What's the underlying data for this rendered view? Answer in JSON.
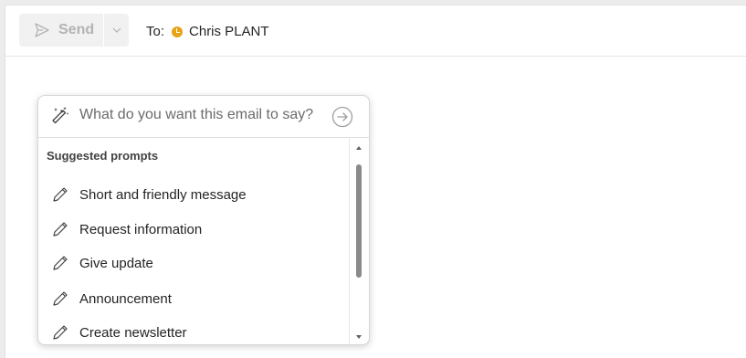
{
  "toolbar": {
    "send_label": "Send",
    "send_icon": "send-icon",
    "dropdown_icon": "chevron-down-icon"
  },
  "recipients": {
    "to_label": "To:",
    "name": "Chris PLANT",
    "presence_status": "away",
    "presence_color": "#e8a317"
  },
  "copilot": {
    "input_placeholder": "What do you want this email to say?",
    "input_value": "",
    "wand_icon": "magic-wand-icon",
    "submit_icon": "arrow-right-circle-icon",
    "section_title": "Suggested prompts",
    "item_icon": "pencil-icon",
    "items": [
      {
        "label": "Short and friendly message"
      },
      {
        "label": "Request information"
      },
      {
        "label": "Give update"
      },
      {
        "label": "Announcement"
      },
      {
        "label": "Create newsletter"
      }
    ]
  }
}
